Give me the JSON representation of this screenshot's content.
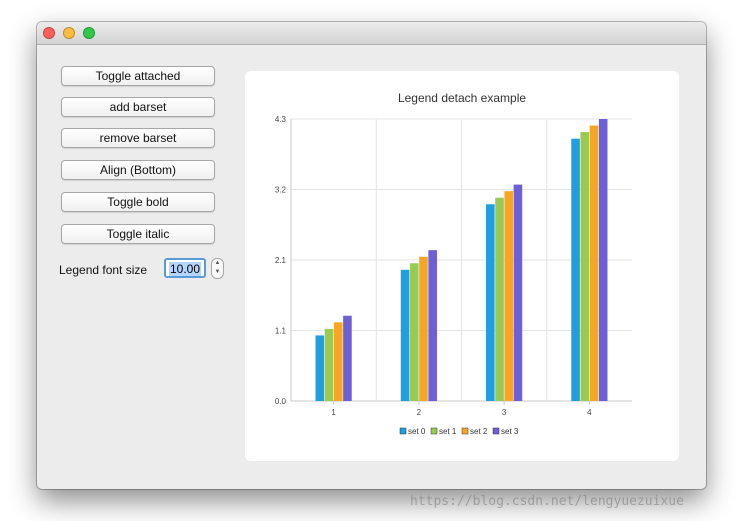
{
  "buttons": {
    "toggle_attached": "Toggle attached",
    "add_barset": "add barset",
    "remove_barset": "remove barset",
    "align": "Align (Bottom)",
    "toggle_bold": "Toggle bold",
    "toggle_italic": "Toggle italic"
  },
  "font_size": {
    "label": "Legend font size",
    "value": "10.00"
  },
  "chart_data": {
    "type": "bar",
    "title": "Legend detach example",
    "categories": [
      "1",
      "2",
      "3",
      "4"
    ],
    "series": [
      {
        "name": "set 0",
        "color": "#209fdf",
        "values": [
          1.0,
          2.0,
          3.0,
          4.0
        ]
      },
      {
        "name": "set 1",
        "color": "#99ca53",
        "values": [
          1.1,
          2.1,
          3.1,
          4.1
        ]
      },
      {
        "name": "set 2",
        "color": "#f6a625",
        "values": [
          1.2,
          2.2,
          3.2,
          4.2
        ]
      },
      {
        "name": "set 3",
        "color": "#6d5fd5",
        "values": [
          1.3,
          2.3,
          3.3,
          4.3
        ]
      }
    ],
    "yticks": [
      "0.0",
      "1.1",
      "2.1",
      "3.2",
      "4.3"
    ],
    "ylim": [
      0,
      4.3
    ],
    "grid": true,
    "legend_position": "bottom"
  },
  "watermark": "https://blog.csdn.net/lengyuezuixue"
}
